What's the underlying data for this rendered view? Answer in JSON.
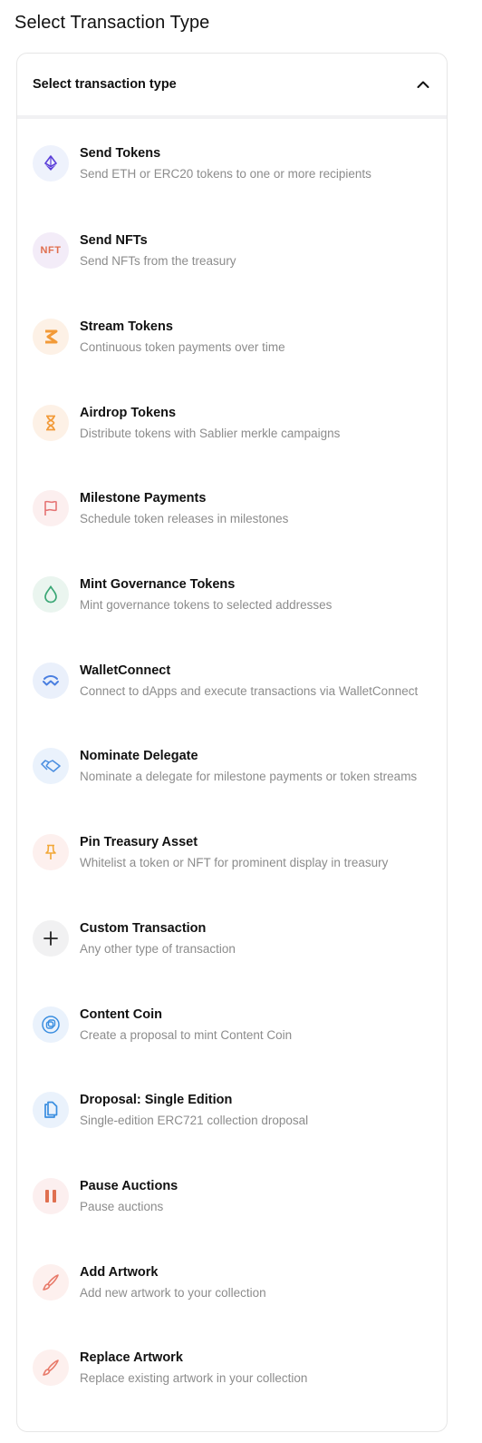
{
  "page": {
    "title": "Select Transaction Type"
  },
  "select": {
    "label": "Select transaction type",
    "expanded": true
  },
  "options": [
    {
      "title": "Send Tokens",
      "description": "Send ETH or ERC20 tokens to one or more recipients",
      "icon": "ethereum-icon",
      "bg": "#eef2fc",
      "color": "#5b3fd9"
    },
    {
      "title": "Send NFTs",
      "description": "Send NFTs from the treasury",
      "icon": "nft-icon",
      "icon_text": "NFT",
      "bg": "#f3ecf8",
      "color": "#e06e4d"
    },
    {
      "title": "Stream Tokens",
      "description": "Continuous token payments over time",
      "icon": "stream-icon",
      "bg": "#fdf1e6",
      "color": "#f29a38"
    },
    {
      "title": "Airdrop Tokens",
      "description": "Distribute tokens with Sablier merkle campaigns",
      "icon": "hourglass-icon",
      "bg": "#fdf1e6",
      "color": "#f29a38"
    },
    {
      "title": "Milestone Payments",
      "description": "Schedule token releases in milestones",
      "icon": "flag-icon",
      "bg": "#fcefef",
      "color": "#e57373"
    },
    {
      "title": "Mint Governance Tokens",
      "description": "Mint governance tokens to selected addresses",
      "icon": "droplet-icon",
      "bg": "#eaf5ef",
      "color": "#3aa775"
    },
    {
      "title": "WalletConnect",
      "description": "Connect to dApps and execute transactions via WalletConnect",
      "icon": "walletconnect-icon",
      "bg": "#eaf0fb",
      "color": "#4a7fe0"
    },
    {
      "title": "Nominate Delegate",
      "description": "Nominate a delegate for milestone payments or token streams",
      "icon": "handshake-icon",
      "bg": "#eaf2fc",
      "color": "#4a8ee0"
    },
    {
      "title": "Pin Treasury Asset",
      "description": "Whitelist a token or NFT for prominent display in treasury",
      "icon": "pin-icon",
      "bg": "#fdf0ee",
      "color": "#f2a838"
    },
    {
      "title": "Custom Transaction",
      "description": "Any other type of transaction",
      "icon": "plus-icon",
      "bg": "#f1f1f2",
      "color": "#222222"
    },
    {
      "title": "Content Coin",
      "description": "Create a proposal to mint Content Coin",
      "icon": "coin-icon",
      "bg": "#eaf2fc",
      "color": "#3a8ee0"
    },
    {
      "title": "Droposal: Single Edition",
      "description": "Single-edition ERC721 collection droposal",
      "icon": "copy-icon",
      "bg": "#eaf2fc",
      "color": "#3a8ee0"
    },
    {
      "title": "Pause Auctions",
      "description": "Pause auctions",
      "icon": "pause-icon",
      "bg": "#fcefef",
      "color": "#e07050"
    },
    {
      "title": "Add Artwork",
      "description": "Add new artwork to your collection",
      "icon": "brush-icon",
      "bg": "#fdf0ee",
      "color": "#e87a6a"
    },
    {
      "title": "Replace Artwork",
      "description": "Replace existing artwork in your collection",
      "icon": "brush-icon",
      "bg": "#fdf0ee",
      "color": "#e87a6a"
    }
  ]
}
